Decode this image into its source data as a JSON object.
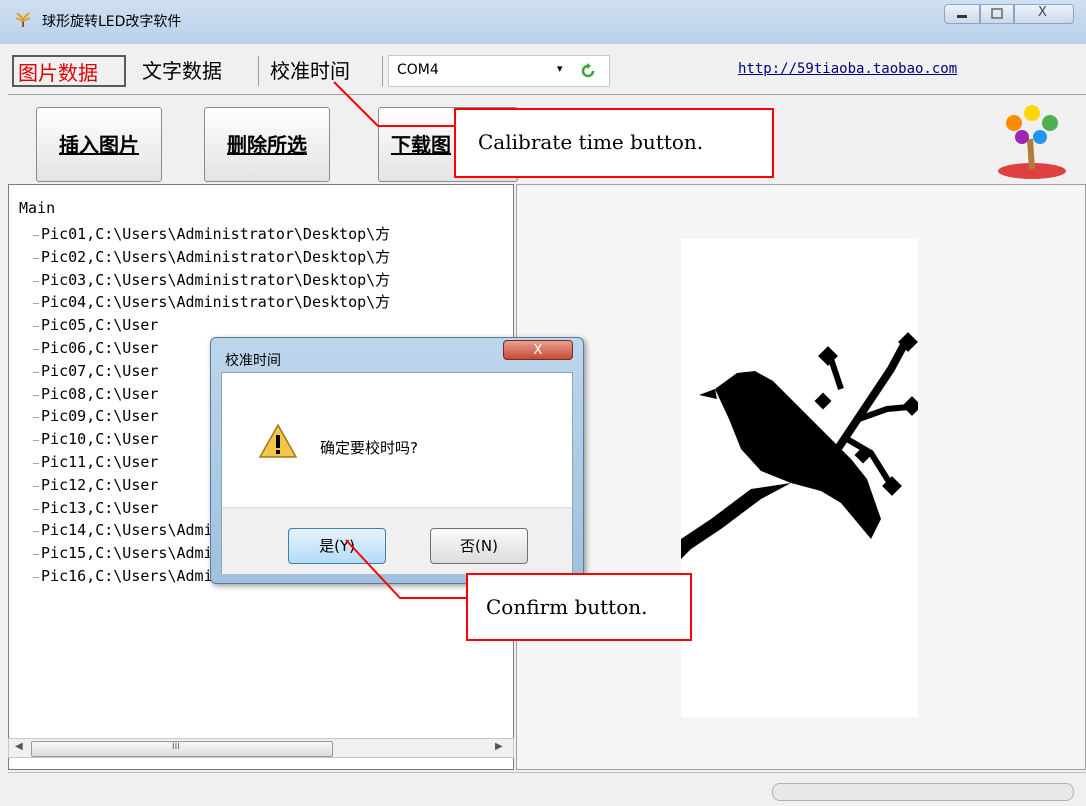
{
  "window": {
    "title": "球形旋转LED改字软件",
    "icons": {
      "app": "tree-logo-icon",
      "minimize": "minimize-icon",
      "maximize": "maximize-icon",
      "close": "close-icon"
    },
    "close_label": "X"
  },
  "tabs": [
    {
      "label": "图片数据",
      "active": true
    },
    {
      "label": "文字数据",
      "active": false
    },
    {
      "label": "校准时间",
      "active": false
    }
  ],
  "port_select": {
    "value": "COM4",
    "refresh_icon": "refresh-icon"
  },
  "link": "http://59tiaoba.taobao.com",
  "toolbar": {
    "insert_label": "插入图片",
    "delete_label": "删除所选",
    "download_label": "下载图"
  },
  "tree": {
    "root": "Main",
    "items": [
      "Pic01,C:\\Users\\Administrator\\Desktop\\方",
      "Pic02,C:\\Users\\Administrator\\Desktop\\方",
      "Pic03,C:\\Users\\Administrator\\Desktop\\方",
      "Pic04,C:\\Users\\Administrator\\Desktop\\方",
      "Pic05,C:\\User",
      "Pic06,C:\\User",
      "Pic07,C:\\User",
      "Pic08,C:\\User",
      "Pic09,C:\\User",
      "Pic10,C:\\User",
      "Pic11,C:\\User",
      "Pic12,C:\\User",
      "Pic13,C:\\User",
      "Pic14,C:\\Users\\Administrator\\Deskt",
      "Pic15,C:\\Users\\Administrator\\Deskt",
      "Pic16,C:\\Users\\Administrator\\Desktop\\方"
    ],
    "scroll_thumb_glyph": "III"
  },
  "preview": {
    "image": "bird-on-branch-icon"
  },
  "dialog": {
    "title": "校准时间",
    "message": "确定要校时吗?",
    "yes_label": "是(Y)",
    "no_label": "否(N)",
    "icon": "warning-icon"
  },
  "annotations": {
    "calibrate": "Calibrate time button.",
    "confirm": "Confirm button."
  },
  "colors": {
    "active_tab": "#e00000",
    "link": "#000080",
    "callout_border": "#ff0000"
  }
}
